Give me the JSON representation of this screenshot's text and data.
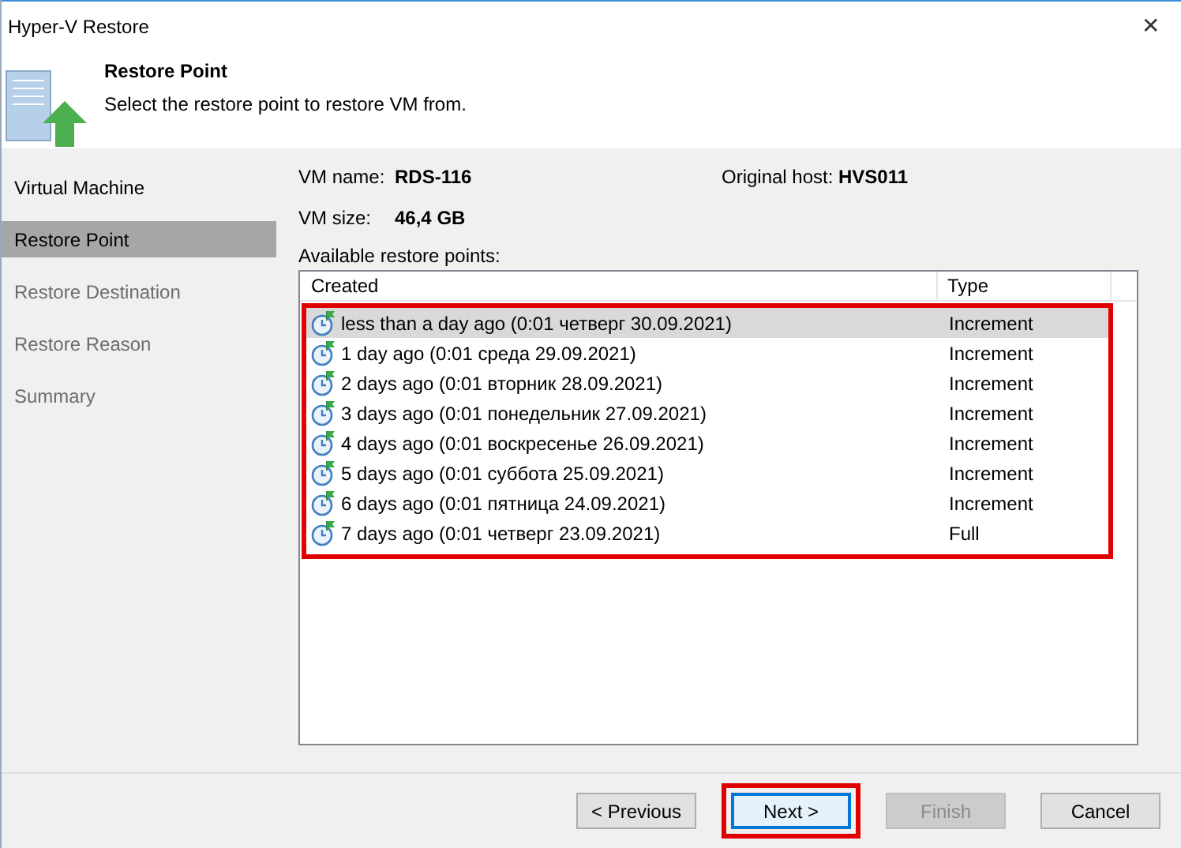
{
  "window": {
    "title": "Hyper-V Restore",
    "close": "✕"
  },
  "header": {
    "title": "Restore Point",
    "subtitle": "Select the restore point to restore VM from."
  },
  "sidebar": {
    "items": [
      {
        "label": "Virtual Machine",
        "selected": false,
        "disabled": false
      },
      {
        "label": "Restore Point",
        "selected": true,
        "disabled": false
      },
      {
        "label": "Restore Destination",
        "selected": false,
        "disabled": true
      },
      {
        "label": "Restore Reason",
        "selected": false,
        "disabled": true
      },
      {
        "label": "Summary",
        "selected": false,
        "disabled": true
      }
    ]
  },
  "vm": {
    "name_label": "VM name:",
    "name": "RDS-116",
    "host_label": "Original host:",
    "host": "HVS011",
    "size_label": "VM size:",
    "size": "46,4 GB"
  },
  "restore_points": {
    "label": "Available restore points:",
    "highlighted": true,
    "columns": [
      "Created",
      "Type"
    ],
    "rows": [
      {
        "created": "less than a day ago (0:01 четверг 30.09.2021)",
        "type": "Increment",
        "selected": true
      },
      {
        "created": "1 day ago (0:01 среда 29.09.2021)",
        "type": "Increment",
        "selected": false
      },
      {
        "created": "2 days ago (0:01 вторник 28.09.2021)",
        "type": "Increment",
        "selected": false
      },
      {
        "created": "3 days ago (0:01 понедельник 27.09.2021)",
        "type": "Increment",
        "selected": false
      },
      {
        "created": "4 days ago (0:01 воскресенье 26.09.2021)",
        "type": "Increment",
        "selected": false
      },
      {
        "created": "5 days ago (0:01 суббота 25.09.2021)",
        "type": "Increment",
        "selected": false
      },
      {
        "created": "6 days ago (0:01 пятница 24.09.2021)",
        "type": "Increment",
        "selected": false
      },
      {
        "created": "7 days ago (0:01 четверг 23.09.2021)",
        "type": "Full",
        "selected": false
      }
    ]
  },
  "buttons": [
    {
      "label": "< Previous",
      "disabled": false,
      "focused": false,
      "highlighted": false
    },
    {
      "label": "Next >",
      "disabled": false,
      "focused": true,
      "highlighted": true
    },
    {
      "label": "Finish",
      "disabled": true,
      "focused": false,
      "highlighted": false
    },
    {
      "label": "Cancel",
      "disabled": false,
      "focused": false,
      "highlighted": false
    }
  ]
}
